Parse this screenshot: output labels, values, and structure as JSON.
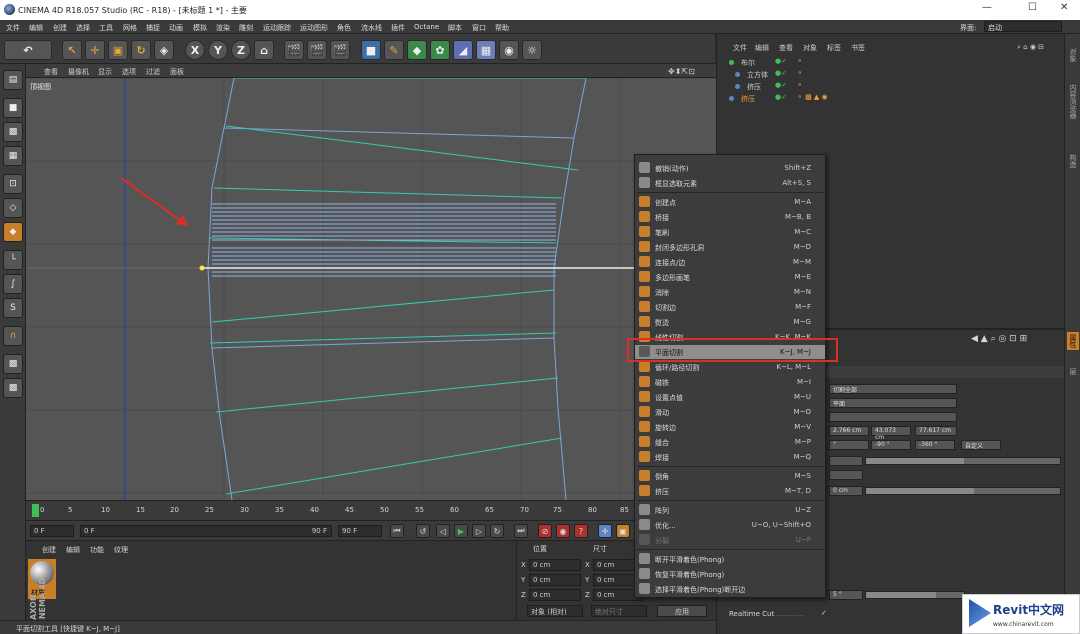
{
  "window": {
    "title": "CINEMA 4D R18.057 Studio (RC - R18) - [未标题 1 *] - 主要"
  },
  "menubar": [
    "文件",
    "编辑",
    "创建",
    "选择",
    "工具",
    "网格",
    "捕捉",
    "动画",
    "模拟",
    "渲染",
    "雕刻",
    "运动跟踪",
    "运动图形",
    "角色",
    "流水线",
    "插件",
    "Octane",
    "脚本",
    "窗口",
    "帮助"
  ],
  "layout_label": "界面:",
  "layout_value": "启动",
  "toolbar": {
    "x_label": "X",
    "y_label": "Y",
    "z_label": "Z"
  },
  "viewport": {
    "menu": [
      "查看",
      "摄像机",
      "显示",
      "选项",
      "过滤",
      "面板"
    ],
    "name": "顶视图"
  },
  "timeline": {
    "ticks": [
      "0",
      "5",
      "10",
      "15",
      "20",
      "25",
      "30",
      "35",
      "40",
      "45",
      "50",
      "55",
      "60",
      "65",
      "70",
      "75",
      "80",
      "85"
    ],
    "start": "0 F",
    "current": "0 F",
    "end": "90 F",
    "end2": "90 F"
  },
  "material_panel": {
    "tabs": [
      "创建",
      "编辑",
      "功能",
      "纹理"
    ],
    "material_name": "材质",
    "brand_top": "MAXON",
    "brand_bottom": "CINEMA 4D"
  },
  "coord_panel": {
    "tab_position": "位置",
    "tab_size": "尺寸",
    "axes": [
      "X",
      "Y",
      "Z"
    ],
    "pos": [
      "0 cm",
      "0 cm",
      "0 cm"
    ],
    "size": [
      "0 cm",
      "0 cm",
      "0 cm"
    ],
    "mode": "对象 (相对)",
    "mode2": "绝对尺寸",
    "apply": "应用"
  },
  "status": "平面切割工具 [快捷键 K~J, M~J]",
  "object_manager": {
    "menu": [
      "文件",
      "编辑",
      "查看",
      "对象",
      "标签",
      "书签"
    ],
    "objects": [
      {
        "name": "布尔"
      },
      {
        "name": "立方体"
      },
      {
        "name": "挤压"
      },
      {
        "name": "挤压"
      }
    ]
  },
  "attr_manager": {
    "fields": [
      "切割全部",
      "平面",
      "2.766 cm",
      "43.073 cm",
      "77.617 cm",
      "°",
      "-90 °",
      "-360 °",
      "自定义",
      "0 cm",
      "5 °"
    ],
    "realtime_label": "Realtime Cut",
    "realtime_dots": "..............",
    "check": "✓"
  },
  "context_menu": {
    "items": [
      {
        "label": "撤销(动作)",
        "shortcut": "Shift+Z"
      },
      {
        "label": "框显选取元素",
        "shortcut": "Alt+S, S"
      },
      {
        "label": "创建点",
        "shortcut": "M~A"
      },
      {
        "label": "桥接",
        "shortcut": "M~B, B"
      },
      {
        "label": "笔刷",
        "shortcut": "M~C"
      },
      {
        "label": "封闭多边形孔洞",
        "shortcut": "M~D"
      },
      {
        "label": "连接点/边",
        "shortcut": "M~M"
      },
      {
        "label": "多边形画笔",
        "shortcut": "M~E"
      },
      {
        "label": "消除",
        "shortcut": "M~N"
      },
      {
        "label": "切割边",
        "shortcut": "M~F"
      },
      {
        "label": "熨烫",
        "shortcut": "M~G"
      },
      {
        "label": "线性切割",
        "shortcut": "K~K, M~K"
      },
      {
        "label": "平面切割",
        "shortcut": "K~J, M~J"
      },
      {
        "label": "循环/路径切割",
        "shortcut": "K~L, M~L"
      },
      {
        "label": "磁铁",
        "shortcut": "M~I"
      },
      {
        "label": "设置点值",
        "shortcut": "M~U"
      },
      {
        "label": "滑动",
        "shortcut": "M~O"
      },
      {
        "label": "旋转边",
        "shortcut": "M~V"
      },
      {
        "label": "缝合",
        "shortcut": "M~P"
      },
      {
        "label": "焊接",
        "shortcut": "M~Q"
      },
      {
        "label": "倒角",
        "shortcut": "M~S"
      },
      {
        "label": "挤压",
        "shortcut": "M~T, D"
      },
      {
        "label": "阵列",
        "shortcut": "U~Z"
      },
      {
        "label": "优化...",
        "shortcut": "U~O, U~Shift+O"
      },
      {
        "label": "分裂",
        "shortcut": "U~P"
      },
      {
        "label": "断开平滑着色(Phong)",
        "shortcut": ""
      },
      {
        "label": "恢复平滑着色(Phong)",
        "shortcut": ""
      },
      {
        "label": "选择平滑着色(Phong)断开边",
        "shortcut": ""
      }
    ]
  },
  "side_tabs": [
    "对象",
    "内容浏览器",
    "构造",
    "属性",
    "层"
  ],
  "watermark": {
    "brand": "Revit中文网",
    "url": "www.chinarevit.com"
  },
  "colors": {
    "highlight": "#d93025",
    "arrow": "#d93025",
    "wire": "#7fa4d8",
    "edge": "#38c9b4"
  }
}
